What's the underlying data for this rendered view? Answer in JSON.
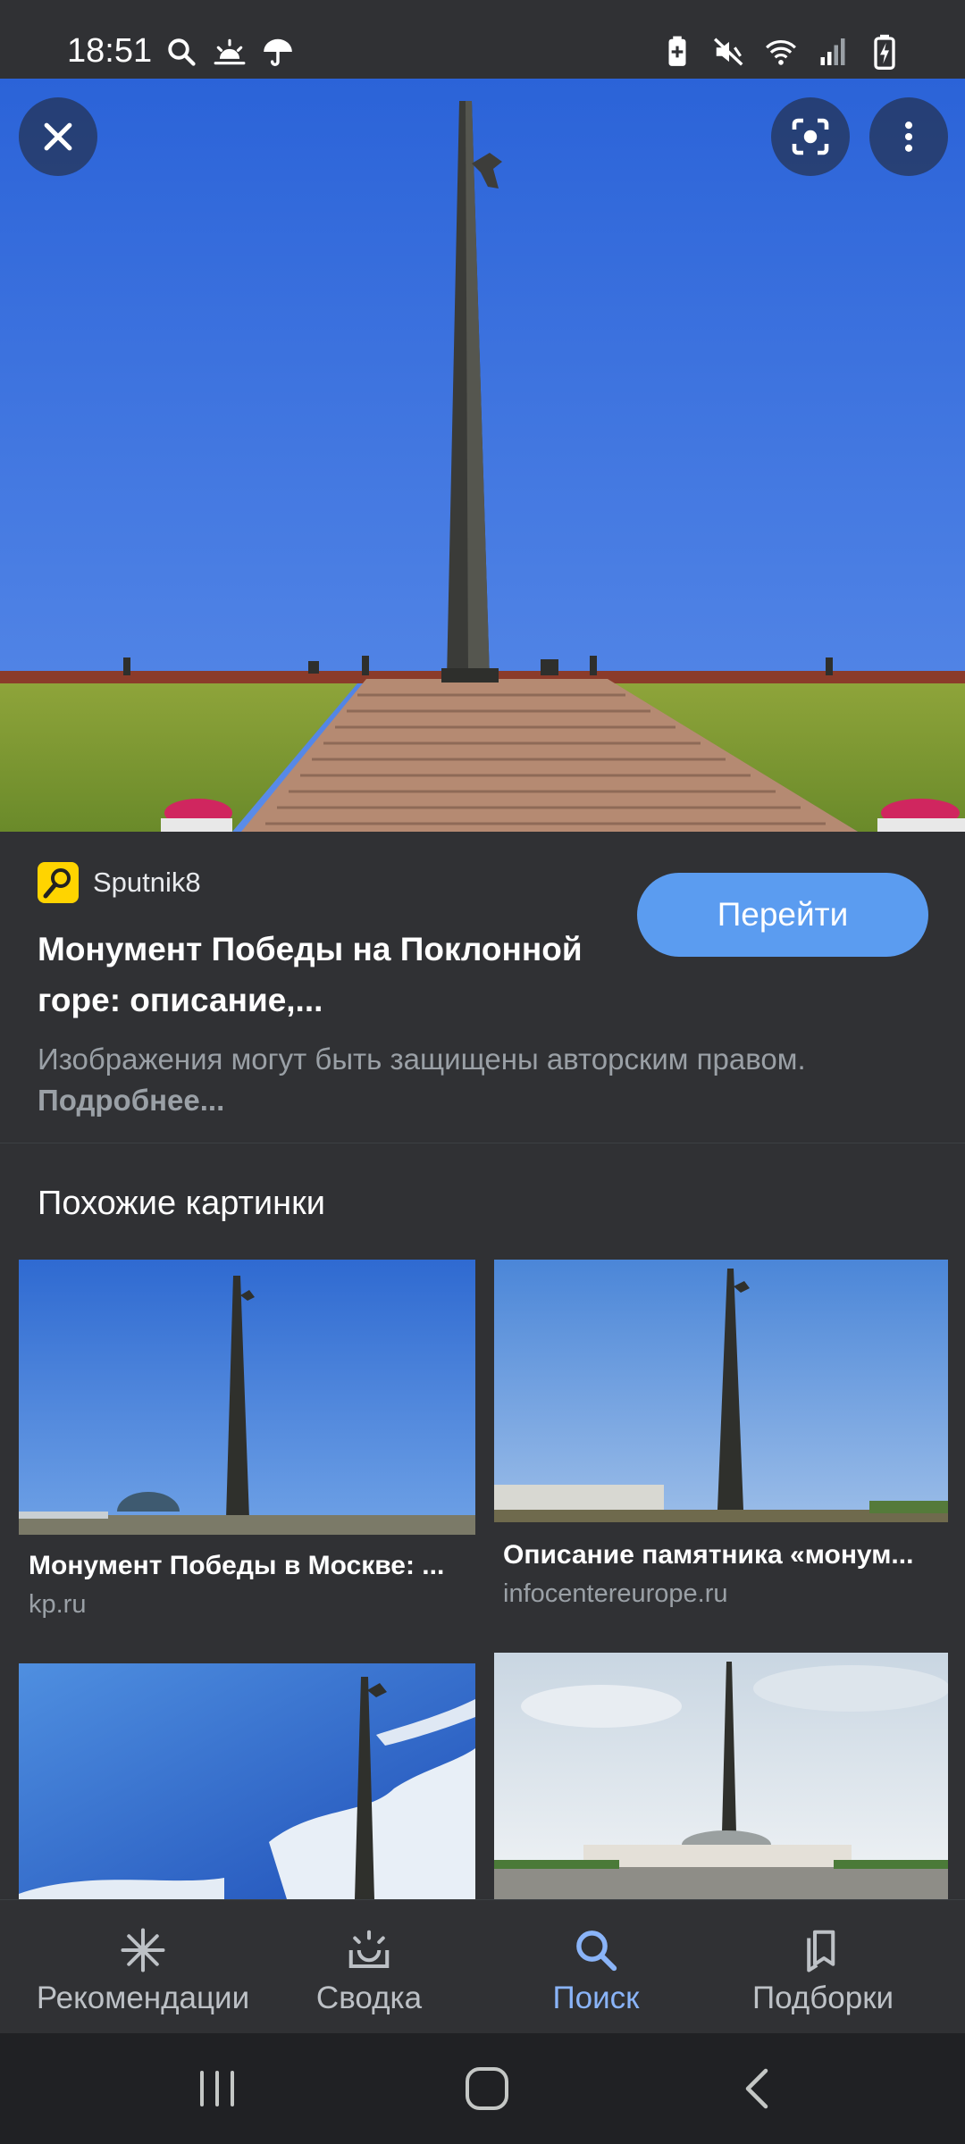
{
  "status_bar": {
    "time": "18:51",
    "left_icons": [
      "search-icon",
      "weather-sun-icon",
      "umbrella-icon"
    ],
    "right_icons": [
      "battery-saver-icon",
      "mute-icon",
      "wifi-icon",
      "signal-icon",
      "battery-icon"
    ]
  },
  "hero": {
    "buttons": [
      "close-icon",
      "lens-icon",
      "more-vert-icon"
    ]
  },
  "result": {
    "source_name": "Sputnik8",
    "title": "Монумент Победы на Поклонной горе: описание,...",
    "visit_label": "Перейти",
    "copyright_text": "Изображения могут быть защищены авторским правом.",
    "copyright_link": "Подробнее..."
  },
  "similar": {
    "heading": "Похожие картинки",
    "items": [
      {
        "title": "Монумент Победы в Москве: ...",
        "source": "kp.ru"
      },
      {
        "title": "Описание памятника «монум...",
        "source": "infocentereurope.ru"
      },
      {
        "title": "",
        "source": ""
      },
      {
        "title": "",
        "source": ""
      }
    ]
  },
  "bottom_nav": {
    "items": [
      {
        "label": "Рекомендации",
        "icon": "asterisk-icon",
        "active": false
      },
      {
        "label": "Сводка",
        "icon": "summary-tray-icon",
        "active": false
      },
      {
        "label": "Поиск",
        "icon": "search-icon",
        "active": true
      },
      {
        "label": "Подборки",
        "icon": "collections-icon",
        "active": false
      }
    ]
  },
  "colors": {
    "background": "#303134",
    "accent": "#5b9cf0",
    "active_nav": "#8ab4f8",
    "secondary_text": "#9aa0a6"
  }
}
